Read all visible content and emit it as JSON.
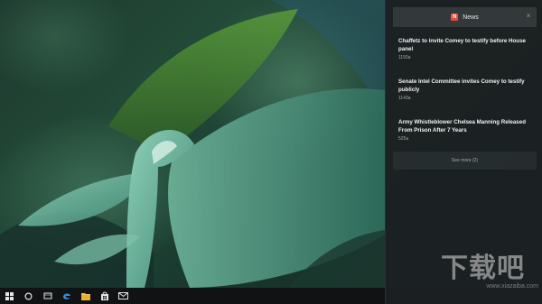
{
  "panel": {
    "app_name": "News",
    "app_icon_glyph": "N",
    "accent_color": "#e64a3d",
    "close_glyph": "×",
    "items": [
      {
        "headline": "Chaffetz to invite Comey to testify before House panel",
        "time": "1150a"
      },
      {
        "headline": "Senate Intel Committee invites Comey to testify publicly",
        "time": "1143a"
      },
      {
        "headline": "Army Whistleblower Chelsea Manning Released From Prison After 7 Years",
        "time": "525a"
      }
    ],
    "see_more": "See more (2)"
  },
  "taskbar": {
    "icons": [
      "windows-start-icon",
      "cortana-search-icon",
      "task-view-icon",
      "edge-browser-icon",
      "file-explorer-icon",
      "store-icon",
      "mail-icon"
    ]
  },
  "watermark": {
    "text": "下载吧",
    "url": "www.xiazaiba.com"
  }
}
